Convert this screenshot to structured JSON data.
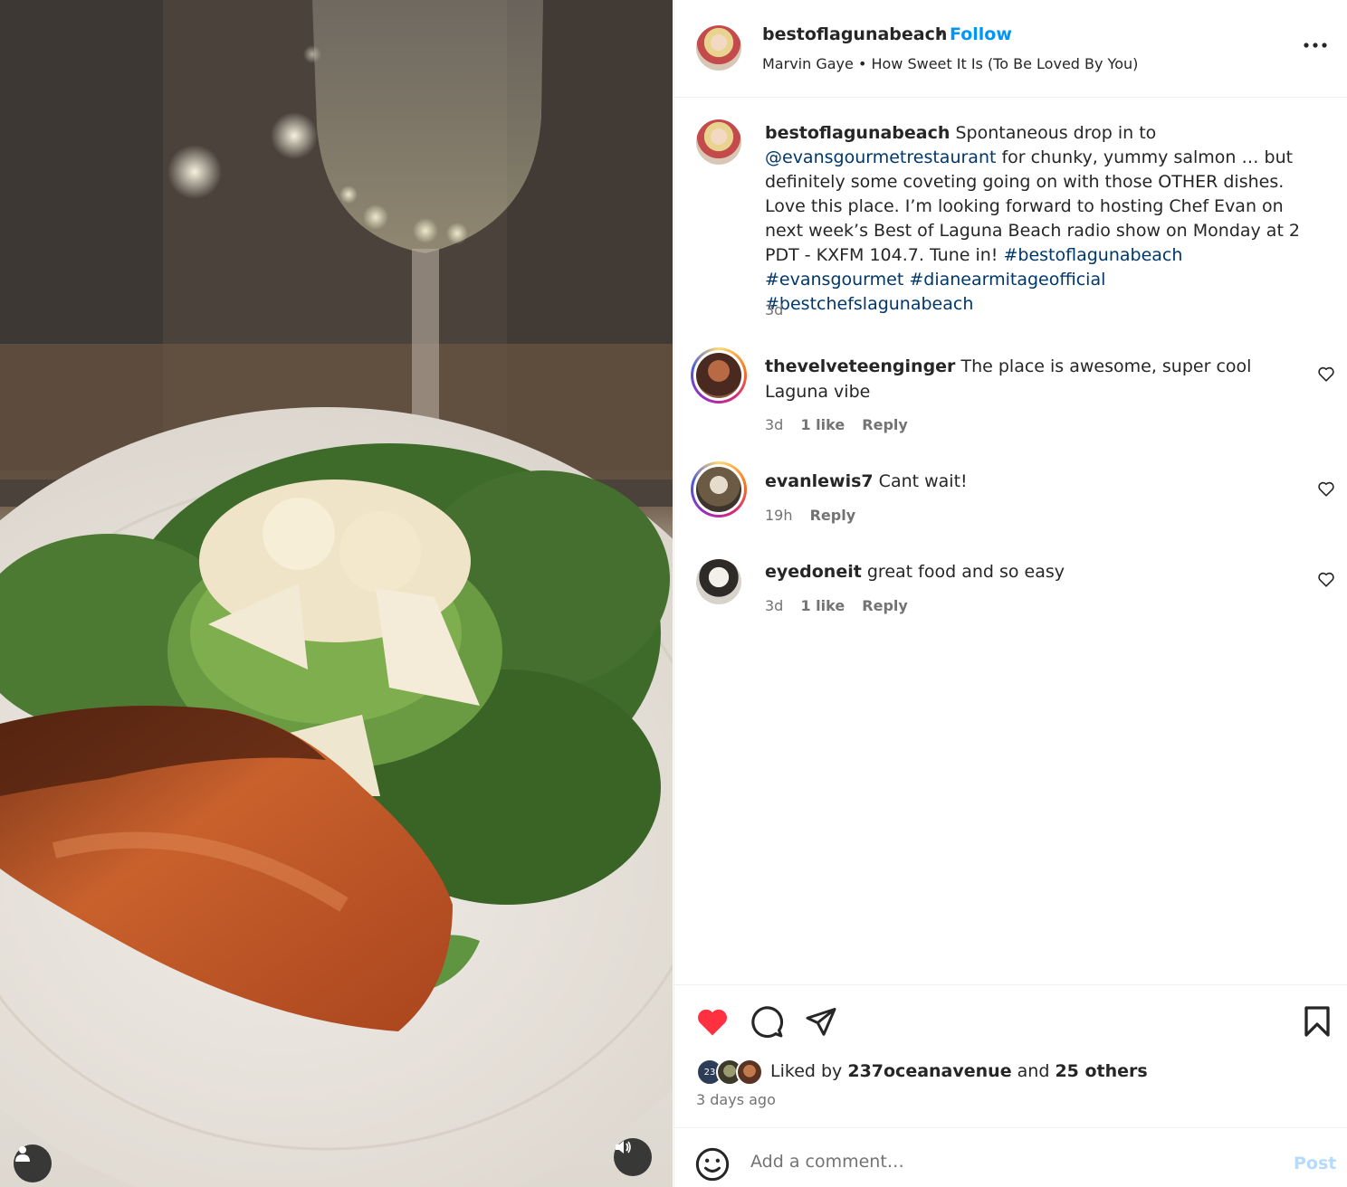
{
  "post": {
    "username": "bestoflagunabeach",
    "separator": "•",
    "follow_label": "Follow",
    "audio_artist": "Marvin Gaye",
    "audio_sep": "•",
    "audio_title": "How Sweet It Is (To Be Loved By You)",
    "more_icon": "more-options-icon"
  },
  "caption": {
    "username": "bestoflagunabeach",
    "text_1": "Spontaneous drop in to",
    "mention": "@evansgourmetrestaurant",
    "text_2": "for chunky, yummy salmon … but definitely some coveting going on with those OTHER dishes. Love this place. I’m looking forward to hosting Chef Evan on next week’s Best of Laguna Beach radio show on Monday at 2 PDT - KXFM 104.7. Tune in!",
    "tag_1": "#bestoflagunabeach",
    "tag_2": "#evansgourmet",
    "tag_3": "#dianearmitageofficial",
    "tag_4": "#bestchefslagunabeach",
    "time": "3d"
  },
  "comments": [
    {
      "username": "thevelveteenginger",
      "text": "The place is awesome, super cool Laguna vibe",
      "time": "3d",
      "likes": "1 like",
      "reply": "Reply"
    },
    {
      "username": "evanlewis7",
      "text": "Cant wait!",
      "time": "19h",
      "reply": "Reply"
    },
    {
      "username": "eyedoneit",
      "text": "great food and so easy",
      "time": "3d",
      "likes": "1 like",
      "reply": "Reply"
    }
  ],
  "actions": {
    "liked": true,
    "like_color": "#ff3040",
    "liked_prefix": "Liked by",
    "liked_user": "237oceanavenue",
    "liked_and": "and",
    "liked_others": "25 others",
    "date": "3 days ago",
    "liker_badge": "23"
  },
  "composer": {
    "placeholder": "Add a comment…",
    "post_label": "Post"
  },
  "colors": {
    "link": "#00376b",
    "follow": "#0095f6",
    "muted": "#737373"
  }
}
